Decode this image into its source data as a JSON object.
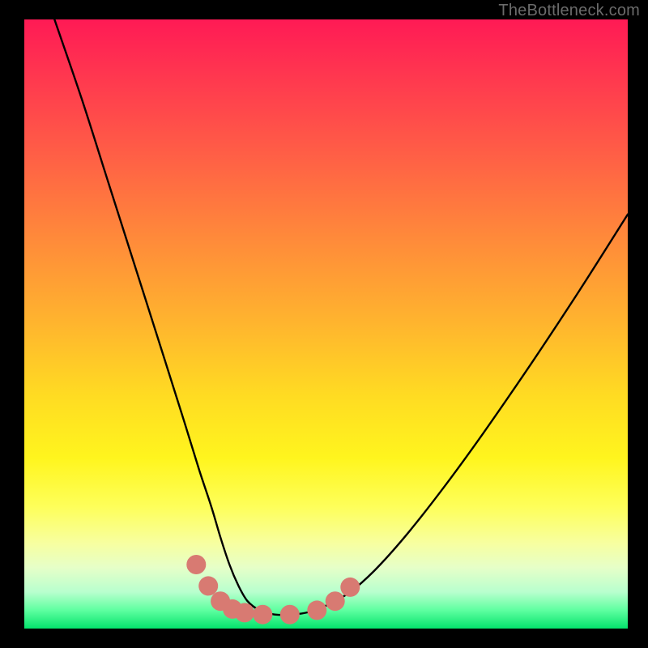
{
  "watermark": "TheBottleneck.com",
  "colors": {
    "curve_stroke": "#000000",
    "marker_fill": "#d87a72",
    "background_black": "#000000"
  },
  "chart_data": {
    "type": "line",
    "title": "",
    "xlabel": "",
    "ylabel": "",
    "xlim": [
      0,
      1
    ],
    "ylim": [
      0,
      1
    ],
    "note": "No axes or tick labels are shown; x and y are normalized to the plotting rectangle (0,0 = top-left of colored area, 1,1 = bottom-right). The curve is a V-shaped bottleneck profile typical of TheBottleneck.com charts.",
    "series": [
      {
        "name": "bottleneck-curve",
        "x": [
          0.05,
          0.095,
          0.14,
          0.185,
          0.23,
          0.265,
          0.29,
          0.31,
          0.325,
          0.34,
          0.355,
          0.37,
          0.39,
          0.415,
          0.445,
          0.475,
          0.505,
          0.54,
          0.58,
          0.63,
          0.69,
          0.76,
          0.84,
          0.92,
          1.0
        ],
        "y": [
          0.0,
          0.13,
          0.27,
          0.41,
          0.55,
          0.66,
          0.74,
          0.8,
          0.85,
          0.895,
          0.93,
          0.955,
          0.97,
          0.977,
          0.977,
          0.972,
          0.96,
          0.94,
          0.905,
          0.85,
          0.775,
          0.68,
          0.565,
          0.445,
          0.32
        ]
      }
    ],
    "markers": {
      "name": "trough-markers",
      "x": [
        0.285,
        0.305,
        0.325,
        0.345,
        0.365,
        0.395,
        0.44,
        0.485,
        0.515,
        0.54
      ],
      "y": [
        0.895,
        0.93,
        0.955,
        0.968,
        0.974,
        0.977,
        0.977,
        0.97,
        0.955,
        0.932
      ]
    }
  }
}
